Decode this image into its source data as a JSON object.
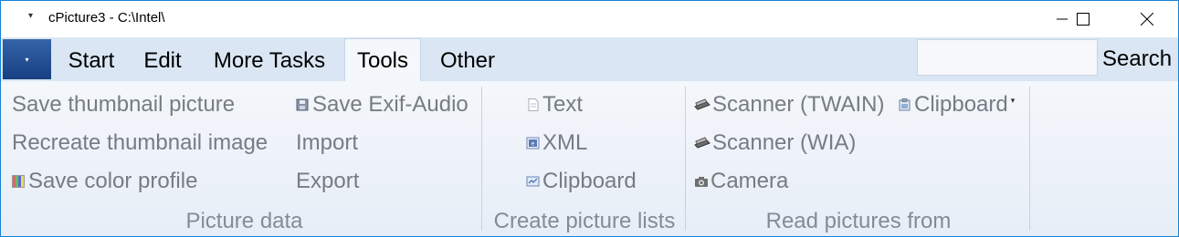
{
  "window": {
    "title": "cPicture3 - C:\\Intel\\",
    "quick_access_glyph": "▾",
    "controls": {
      "minimize": "minimize-icon",
      "maximize": "maximize-icon",
      "close": "close-icon"
    }
  },
  "ribbon": {
    "app_button_glyph": "▾",
    "tabs": [
      {
        "label": "Start",
        "active": false
      },
      {
        "label": "Edit",
        "active": false
      },
      {
        "label": "More Tasks",
        "active": false
      },
      {
        "label": "Tools",
        "active": true
      },
      {
        "label": "Other",
        "active": false
      }
    ],
    "search": {
      "value": "",
      "label": "Search"
    }
  },
  "groups": {
    "picture_data": {
      "label": "Picture data",
      "items": {
        "save_thumbnail": "Save thumbnail picture",
        "recreate_thumbnail": "Recreate thumbnail image",
        "save_color_profile": "Save color profile",
        "save_exif_audio": "Save Exif-Audio",
        "import": "Import",
        "export": "Export"
      }
    },
    "create_picture_lists": {
      "label": "Create picture lists",
      "items": {
        "text": "Text",
        "xml": "XML",
        "clipboard": "Clipboard"
      }
    },
    "read_pictures_from": {
      "label": "Read pictures from",
      "items": {
        "scanner_twain": "Scanner (TWAIN)",
        "scanner_wia": "Scanner (WIA)",
        "camera": "Camera",
        "clipboard": "Clipboard",
        "clipboard_dropdown_glyph": "▾"
      }
    }
  },
  "colors": {
    "accent_border": "#1883d7",
    "ribbon_bg": "#dae6f3",
    "disabled_text": "#777c84"
  }
}
